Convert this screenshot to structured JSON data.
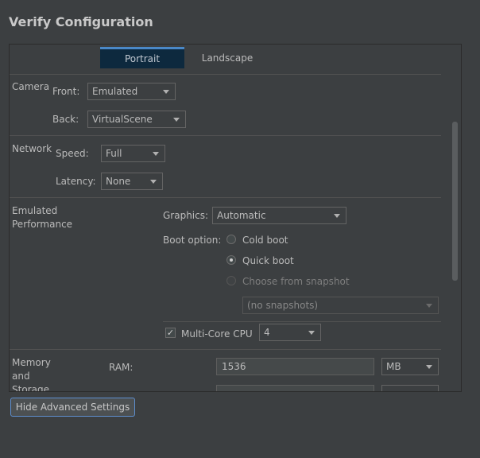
{
  "window": {
    "title": "Verify Configuration"
  },
  "orientation": {
    "tabs": [
      {
        "label": "Portrait",
        "selected": true
      },
      {
        "label": "Landscape",
        "selected": false
      }
    ]
  },
  "camera": {
    "section_label": "Camera",
    "front_label": "Front:",
    "front_value": "Emulated",
    "back_label": "Back:",
    "back_value": "VirtualScene"
  },
  "network": {
    "section_label": "Network",
    "speed_label": "Speed:",
    "speed_value": "Full",
    "latency_label": "Latency:",
    "latency_value": "None"
  },
  "performance": {
    "section_label_line1": "Emulated",
    "section_label_line2": "Performance",
    "graphics_label": "Graphics:",
    "graphics_value": "Automatic",
    "boot_label": "Boot option:",
    "boot_options": [
      {
        "label": "Cold boot",
        "checked": false,
        "enabled": true
      },
      {
        "label": "Quick boot",
        "checked": true,
        "enabled": true
      },
      {
        "label": "Choose from snapshot",
        "checked": false,
        "enabled": false
      }
    ],
    "snapshot_value": "(no snapshots)",
    "multicore_label": "Multi-Core CPU",
    "multicore_checked": true,
    "multicore_value": "4"
  },
  "memory": {
    "section_label_line1": "Memory",
    "section_label_line2": "and",
    "section_label_line3": "Storage",
    "ram_label": "RAM:",
    "ram_value": "1536",
    "ram_unit": "MB"
  },
  "footer": {
    "advanced_button_label": "Hide Advanced Settings"
  },
  "colors": {
    "background": "#3c3f41",
    "selected_tab": "#0d293e",
    "focus_border": "#5e8fcf"
  }
}
